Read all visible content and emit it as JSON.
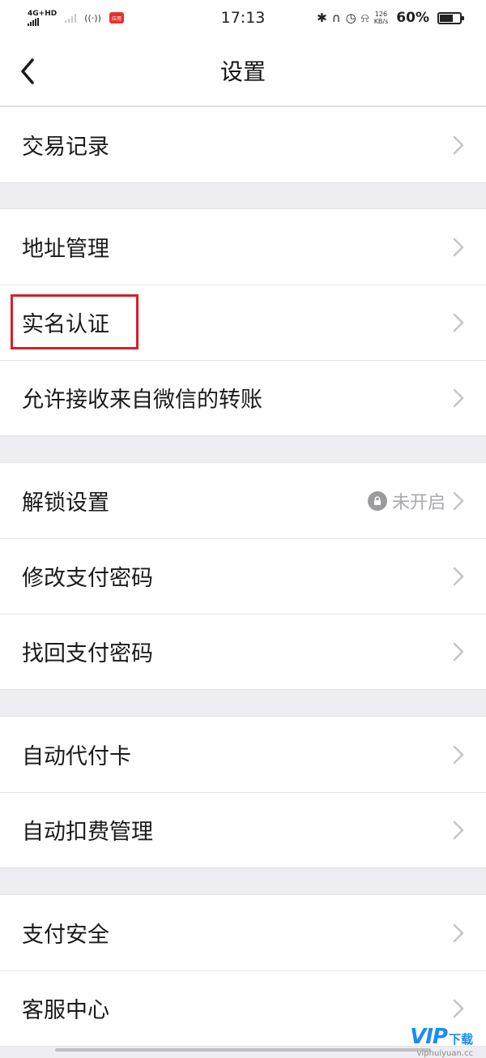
{
  "status_bar": {
    "network": "4G+HD",
    "hotspot_icon": "wifi-hotspot-icon",
    "app_badge": "应用",
    "time": "17:13",
    "speed_top": "126",
    "speed_bottom": "KB/s",
    "battery_percent": "60%",
    "battery_level": 0.6
  },
  "nav": {
    "title": "设置",
    "back_icon": "chevron-left-icon"
  },
  "groups": [
    {
      "items": [
        {
          "label": "交易记录"
        }
      ]
    },
    {
      "items": [
        {
          "label": "地址管理"
        },
        {
          "label": "实名认证",
          "highlighted": true
        },
        {
          "label": "允许接收来自微信的转账"
        }
      ]
    },
    {
      "items": [
        {
          "label": "解锁设置",
          "status": "未开启",
          "status_icon": "lock-icon"
        },
        {
          "label": "修改支付密码"
        },
        {
          "label": "找回支付密码"
        }
      ]
    },
    {
      "items": [
        {
          "label": "自动代付卡"
        },
        {
          "label": "自动扣费管理"
        }
      ]
    },
    {
      "items": [
        {
          "label": "支付安全"
        },
        {
          "label": "客服中心"
        }
      ]
    }
  ],
  "highlight_color": "#d7202a",
  "watermark": {
    "brand": "VIP",
    "cn": "下载",
    "url": "viphuiyuan.cc"
  }
}
